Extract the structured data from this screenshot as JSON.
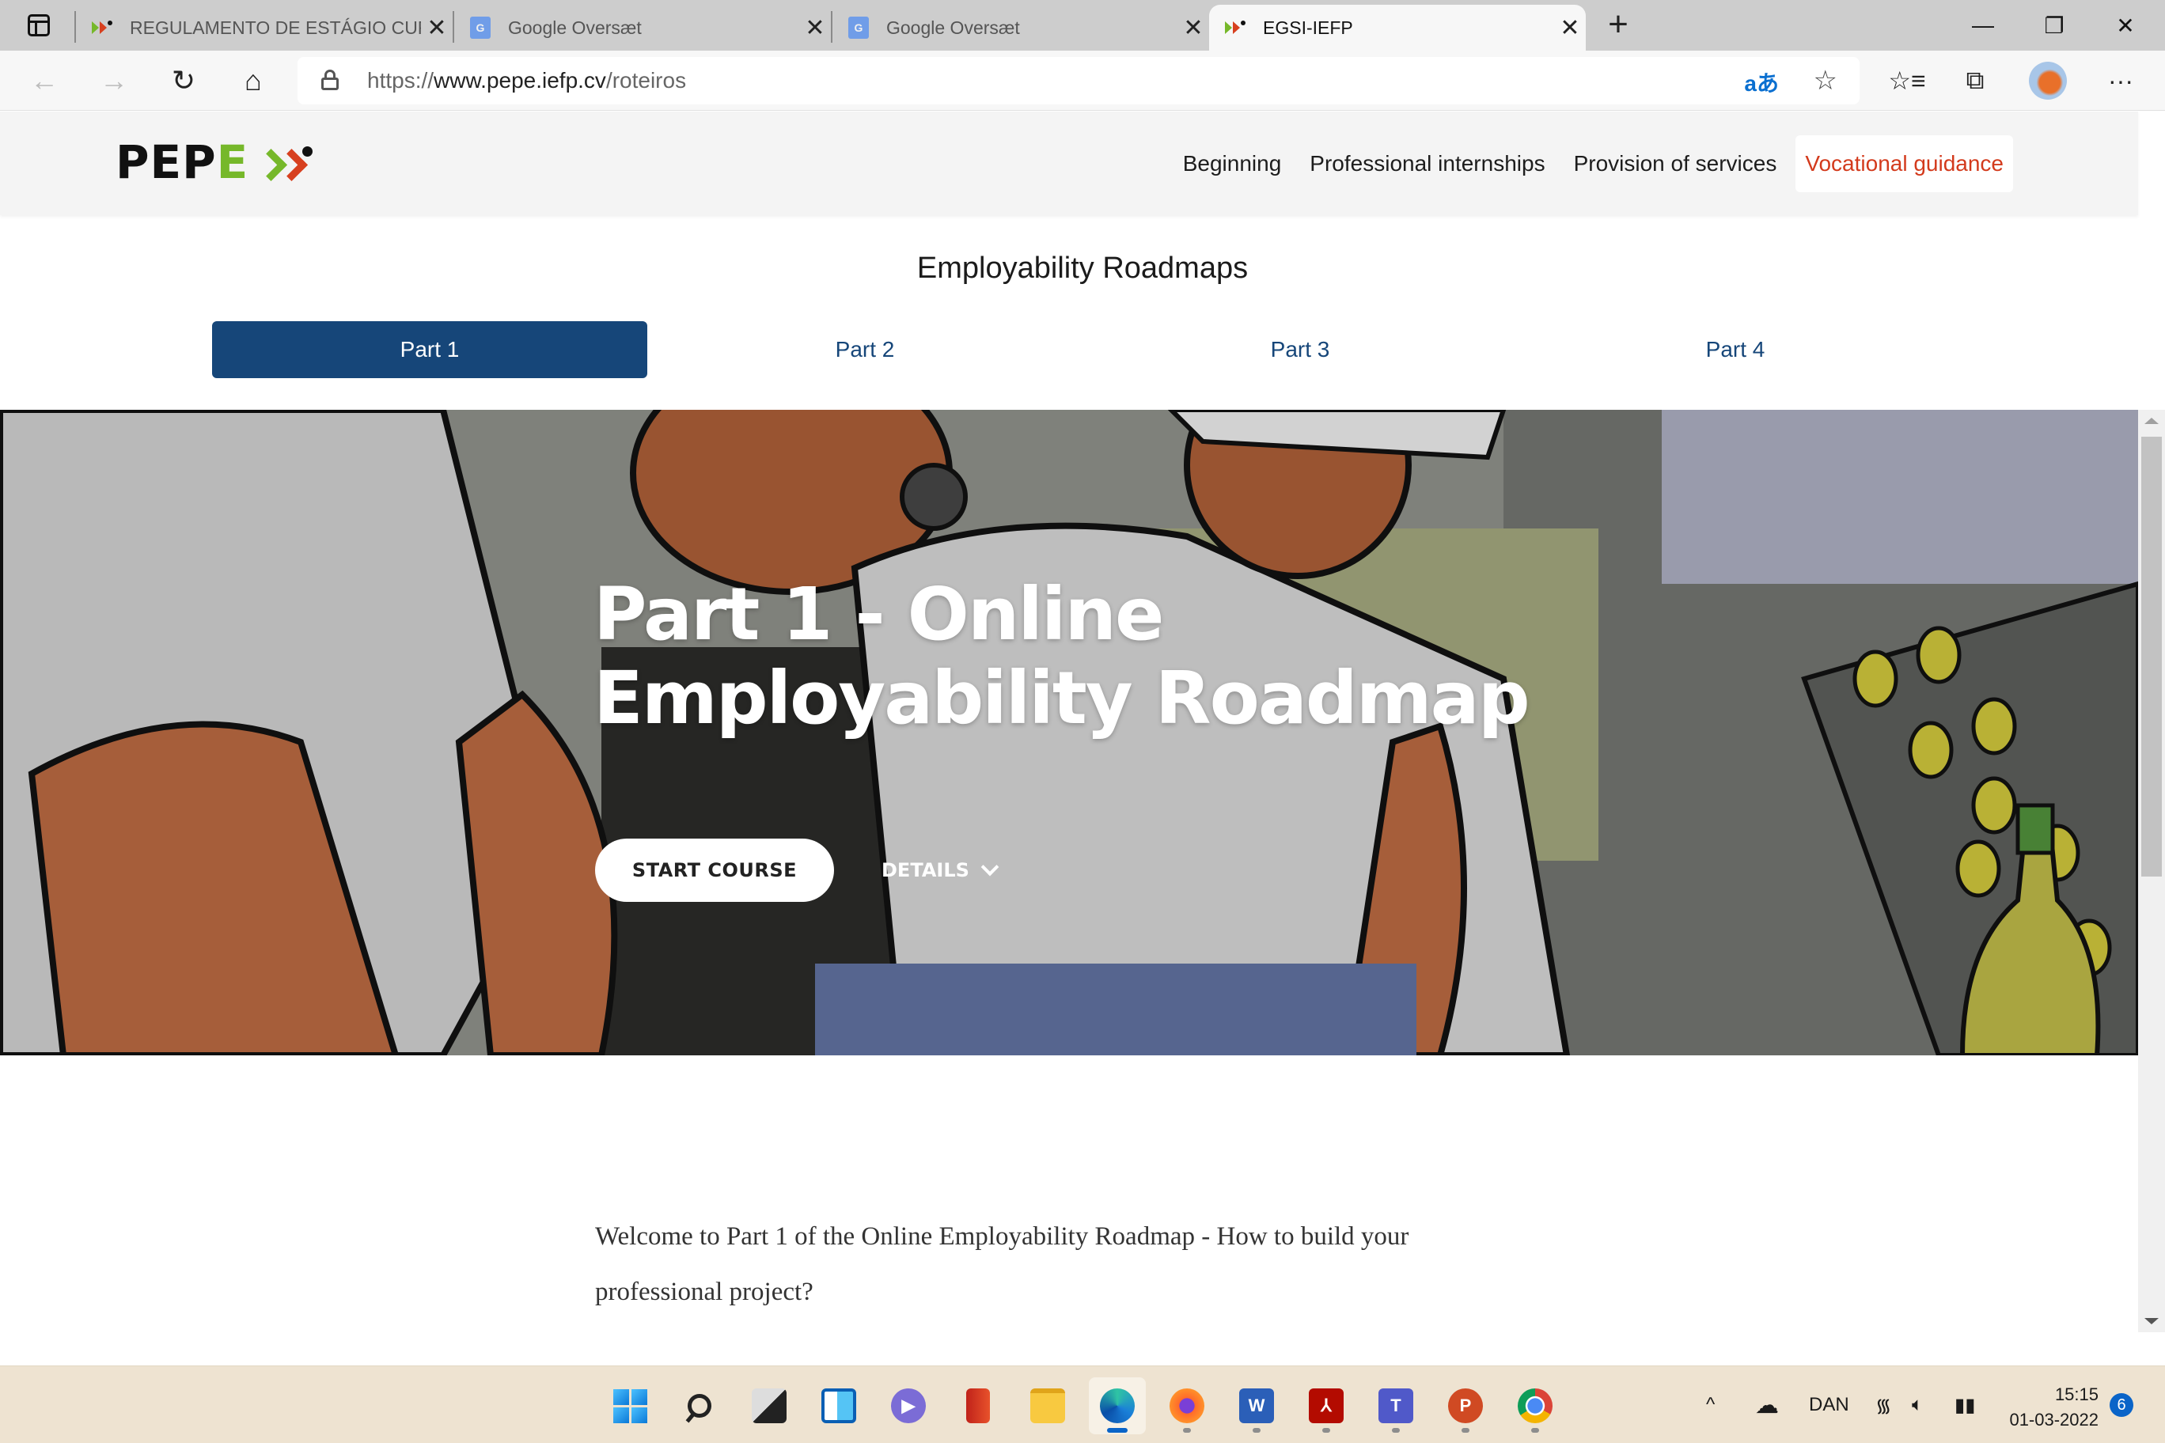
{
  "browser": {
    "tabs": [
      {
        "title": "REGULAMENTO DE ESTÁGIO CURRICULAR",
        "favicon": "pepe-favicon",
        "active": false
      },
      {
        "title": "Google Oversæt",
        "favicon": "google-translate-favicon",
        "active": false
      },
      {
        "title": "Google Oversæt",
        "favicon": "google-translate-favicon",
        "active": false
      },
      {
        "title": "EGSI-IEFP",
        "favicon": "pepe-favicon",
        "active": true
      }
    ],
    "close_glyph": "✕",
    "new_tab_glyph": "+",
    "window_controls": {
      "minimize": "—",
      "restore": "❐",
      "close": "✕"
    },
    "address": {
      "scheme": "https://",
      "host": "www.pepe.iefp.cv",
      "path": "/roteiros"
    },
    "toolbar_icons": [
      "back-icon",
      "forward-icon",
      "refresh-icon",
      "home-icon",
      "translate-icon",
      "add-favorite-icon",
      "favorites-icon",
      "collections-icon",
      "profile-avatar",
      "more-icon"
    ],
    "glyphs": {
      "back": "←",
      "forward": "→",
      "refresh": "↻",
      "home": "⌂",
      "translate": "aあ",
      "add_favorite": "☆",
      "favorites": "☆≡",
      "collections": "⧉",
      "more": "···"
    }
  },
  "site": {
    "logo": {
      "text_black": "PEP",
      "text_green": "E"
    },
    "nav": [
      {
        "label": "Beginning",
        "active": false
      },
      {
        "label": "Professional internships",
        "active": false
      },
      {
        "label": "Provision of services",
        "active": false
      },
      {
        "label": "Vocational guidance",
        "active": true
      }
    ],
    "colors": {
      "brand_green": "#76b82a",
      "brand_red": "#d7401f",
      "nav_active": "#d33a1c",
      "primary_blue": "#164679"
    }
  },
  "main": {
    "title": "Employability Roadmaps",
    "parts": [
      {
        "label": "Part 1",
        "active": true
      },
      {
        "label": "Part 2",
        "active": false
      },
      {
        "label": "Part 3",
        "active": false
      },
      {
        "label": "Part 4",
        "active": false
      }
    ],
    "hero": {
      "title": "Part 1 - Online Employability Roadmap",
      "start_button": "START COURSE",
      "details_button": "DETAILS"
    },
    "intro": "Welcome to Part 1 of the Online Employability Roadmap - How to build your professional project?"
  },
  "taskbar": {
    "apps": [
      {
        "name": "start",
        "running": false
      },
      {
        "name": "search",
        "running": false
      },
      {
        "name": "task-view",
        "running": false
      },
      {
        "name": "widgets",
        "running": false
      },
      {
        "name": "chat",
        "running": false
      },
      {
        "name": "office",
        "running": false
      },
      {
        "name": "file-explorer",
        "running": false
      },
      {
        "name": "edge",
        "running": true,
        "active": true
      },
      {
        "name": "firefox",
        "running": true
      },
      {
        "name": "word",
        "running": true
      },
      {
        "name": "acrobat",
        "running": true
      },
      {
        "name": "teams",
        "running": true
      },
      {
        "name": "powerpoint",
        "running": true
      },
      {
        "name": "chrome",
        "running": true
      }
    ],
    "tray": {
      "chevron": "^",
      "language": "DAN",
      "time": "15:15",
      "date": "01-03-2022",
      "notifications": "6"
    }
  }
}
